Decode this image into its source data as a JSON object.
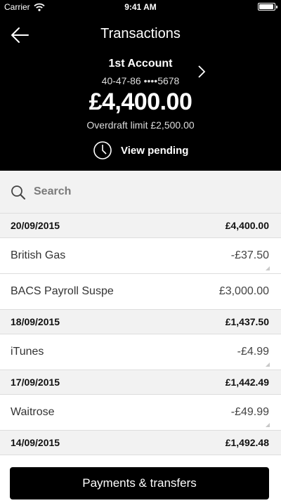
{
  "status_bar": {
    "carrier": "Carrier",
    "time": "9:41 AM",
    "wifi_icon": "wifi-icon",
    "battery_icon": "battery-icon"
  },
  "nav": {
    "title": "Transactions",
    "back_icon": "back-arrow-icon"
  },
  "account": {
    "name": "1st Account",
    "number": "40-47-86 ••••5678",
    "balance": "£4,400.00",
    "overdraft": "Overdraft limit £2,500.00",
    "chevron_icon": "chevron-right-icon"
  },
  "pending": {
    "label": "View pending",
    "icon": "clock-icon"
  },
  "search": {
    "placeholder": "Search",
    "value": "",
    "icon": "search-icon"
  },
  "groups": [
    {
      "date": "20/09/2015",
      "total": "£4,400.00",
      "transactions": [
        {
          "description": "British Gas",
          "amount": "-£37.50"
        },
        {
          "description": "BACS Payroll Suspe",
          "amount": "£3,000.00"
        }
      ]
    },
    {
      "date": "18/09/2015",
      "total": "£1,437.50",
      "transactions": [
        {
          "description": "iTunes",
          "amount": "-£4.99"
        }
      ]
    },
    {
      "date": "17/09/2015",
      "total": "£1,442.49",
      "transactions": [
        {
          "description": "Waitrose",
          "amount": "-£49.99"
        }
      ]
    },
    {
      "date": "14/09/2015",
      "total": "£1,492.48",
      "transactions": []
    }
  ],
  "footer": {
    "button_label": "Payments & transfers"
  },
  "colors": {
    "header_bg": "#000000",
    "section_bg": "#f2f2f2",
    "button_bg": "#000000"
  }
}
